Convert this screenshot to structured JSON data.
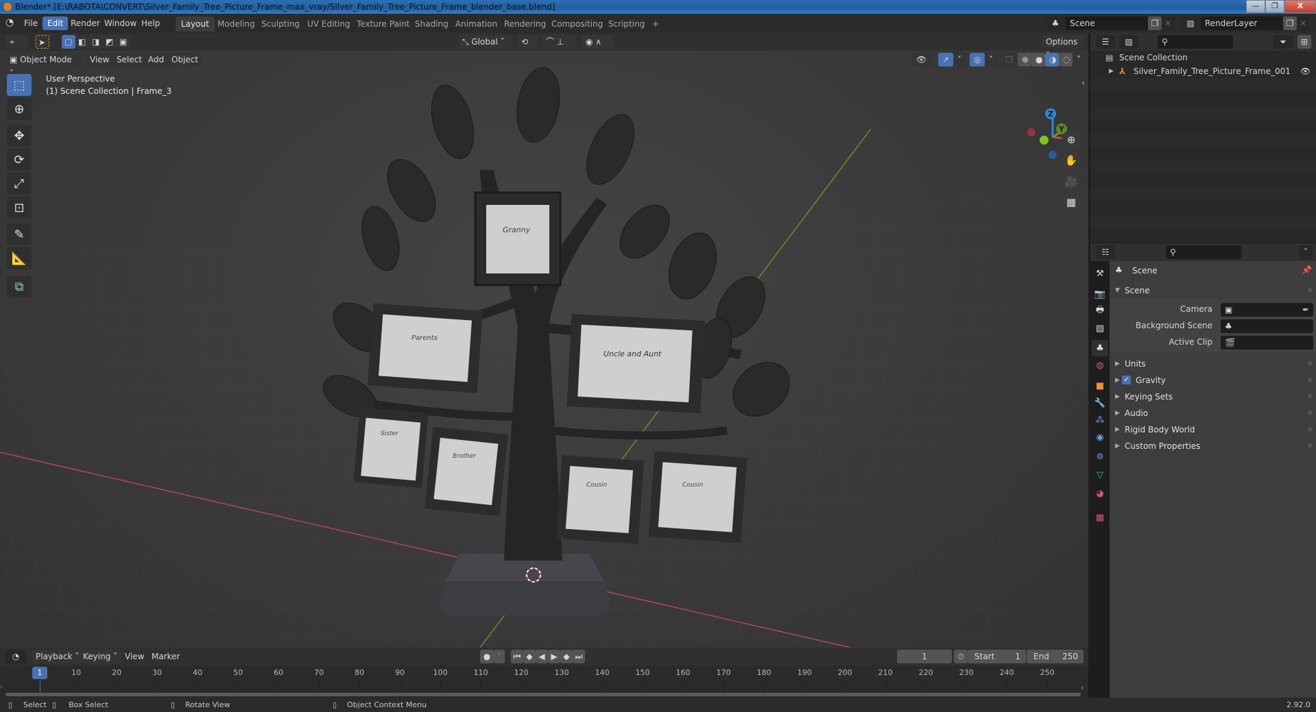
{
  "window": {
    "title": "Blender* [E:\\RABOTA\\CONVERT\\Silver_Family_Tree_Picture_Frame_max_vray/Silver_Family_Tree_Picture_Frame_blender_base.blend]",
    "controls": {
      "minimize": "—",
      "maximize": "❐",
      "close": "X"
    }
  },
  "menubar": {
    "items": [
      "File",
      "Edit",
      "Render",
      "Window",
      "Help"
    ],
    "active": "Edit"
  },
  "workspaces": {
    "tabs": [
      "Layout",
      "Modeling",
      "Sculpting",
      "UV Editing",
      "Texture Paint",
      "Shading",
      "Animation",
      "Rendering",
      "Compositing",
      "Scripting"
    ],
    "active": "Layout",
    "add_label": "+"
  },
  "scene_selector": {
    "value": "Scene"
  },
  "layer_selector": {
    "value": "RenderLayer"
  },
  "viewport": {
    "header": {
      "transform_orientation": "Global",
      "options_label": "Options",
      "mode": "Object Mode",
      "menus": [
        "View",
        "Select",
        "Add",
        "Object"
      ]
    },
    "overlay_text": {
      "perspective": "User Perspective",
      "collection": "(1) Scene Collection | Frame_3"
    },
    "gizmo": {
      "x": "X",
      "y": "Y",
      "z": "Z"
    },
    "tools": [
      "select-box",
      "cursor",
      "move",
      "rotate",
      "scale",
      "transform",
      "annotate",
      "measure",
      "add-cube"
    ],
    "nav_buttons": [
      "zoom",
      "pan",
      "camera",
      "perspective-toggle"
    ],
    "shading_modes": [
      "wireframe",
      "solid",
      "material-preview",
      "rendered"
    ],
    "shading_active": "material-preview",
    "frame_labels": [
      "Granny",
      "Parents",
      "Uncle and Aunt",
      "Sister",
      "Brother",
      "Cousin",
      "Cousin"
    ],
    "colors": {
      "x_axis": "#c5404f",
      "y_axis": "#7aa02a",
      "z_axis": "#2f86d8",
      "accent": "#4772b3"
    }
  },
  "outliner": {
    "root": "Scene Collection",
    "items": [
      {
        "name": "Silver_Family_Tree_Picture_Frame_001",
        "visible": true
      }
    ]
  },
  "properties": {
    "context_title": "Scene",
    "sections": {
      "scene": {
        "title": "Scene",
        "expanded": true,
        "fields": [
          {
            "label": "Camera",
            "value": ""
          },
          {
            "label": "Background Scene",
            "value": ""
          },
          {
            "label": "Active Clip",
            "value": ""
          }
        ]
      },
      "collapsed": [
        {
          "title": "Units"
        },
        {
          "title": "Gravity",
          "checkbox": true,
          "checked": true
        },
        {
          "title": "Keying Sets"
        },
        {
          "title": "Audio"
        },
        {
          "title": "Rigid Body World"
        },
        {
          "title": "Custom Properties"
        }
      ]
    },
    "tabs": [
      "tool",
      "render",
      "output",
      "view-layer",
      "scene",
      "world",
      "object",
      "modifiers",
      "particles",
      "physics",
      "constraints",
      "data",
      "material",
      "texture"
    ],
    "active_tab": "scene"
  },
  "timeline": {
    "menus": [
      "Playback",
      "Keying",
      "View",
      "Marker"
    ],
    "current_frame": "1",
    "start_label": "Start",
    "start": "1",
    "end_label": "End",
    "end": "250",
    "ruler_ticks": [
      "10",
      "20",
      "30",
      "40",
      "50",
      "60",
      "70",
      "80",
      "90",
      "100",
      "110",
      "120",
      "130",
      "140",
      "150",
      "160",
      "170",
      "180",
      "190",
      "200",
      "210",
      "220",
      "230",
      "240",
      "250"
    ],
    "playhead": "1"
  },
  "statusbar": {
    "hints": [
      {
        "label": "Select"
      },
      {
        "label": "Box Select"
      },
      {
        "label": "Rotate View"
      },
      {
        "label": "Object Context Menu"
      }
    ],
    "version": "2.92.0"
  }
}
